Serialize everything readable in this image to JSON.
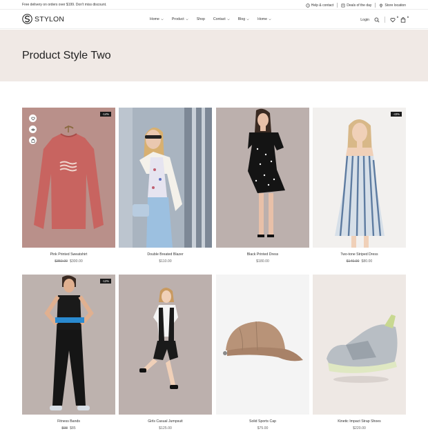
{
  "topbar": {
    "promo": "Free delivery on orders over $199. Don't miss discount.",
    "links": [
      {
        "label": "Help & contact",
        "icon": "help-icon"
      },
      {
        "label": "Deals of the day",
        "icon": "tag-icon"
      },
      {
        "label": "Store location",
        "icon": "location-pin-icon"
      }
    ]
  },
  "header": {
    "logo": "STYLON",
    "nav": [
      "Home",
      "Product",
      "Shop",
      "Contact",
      "Blog",
      "Home"
    ],
    "login": "Login",
    "wishlist_count": "0",
    "cart_count": "0"
  },
  "banner": {
    "title": "Product Style Two"
  },
  "products": [
    {
      "name": "Pink Printed Sweatshirt",
      "old_price": "$350.00",
      "price": "$300.00",
      "discount": "-14%"
    },
    {
      "name": "Double Breated Blazer",
      "old_price": "",
      "price": "$110.00",
      "discount": ""
    },
    {
      "name": "Black Printed Dress",
      "old_price": "",
      "price": "$180.00",
      "discount": ""
    },
    {
      "name": "Two-tone Striped Dress",
      "old_price": "$140.00",
      "price": "$80.00",
      "discount": "-43%"
    },
    {
      "name": "Fitness Bands",
      "old_price": "$98",
      "price": "$85",
      "discount": "-12%"
    },
    {
      "name": "Girls Casual Jumpsuit",
      "old_price": "",
      "price": "$125.00",
      "discount": ""
    },
    {
      "name": "Solid Sports Cap",
      "old_price": "",
      "price": "$75.00",
      "discount": ""
    },
    {
      "name": "Kinetic Impact Strap Shoes",
      "old_price": "",
      "price": "$220.00",
      "discount": ""
    }
  ],
  "colors": {
    "banner_bg": "#f0e9e5",
    "photo_bg": "#bcb0ad",
    "badge_bg": "#1a1a1a"
  }
}
